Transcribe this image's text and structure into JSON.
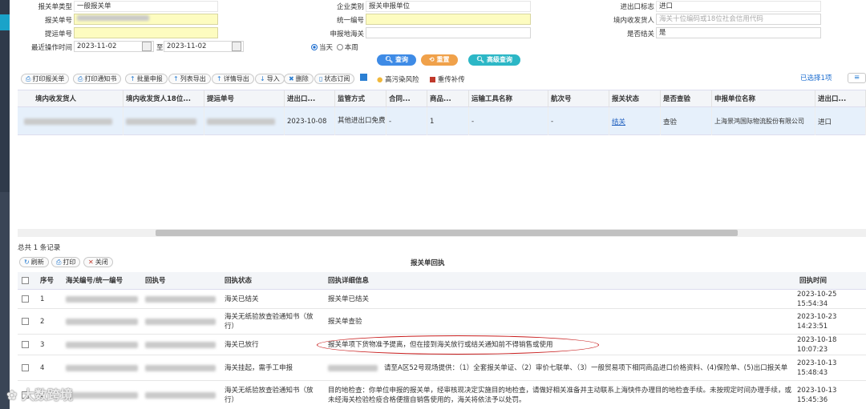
{
  "filters": {
    "decl_type_label": "报关单类型",
    "decl_type_value": "一般报关单",
    "enterprise_type_label": "企业类别",
    "enterprise_type_value": "报关申报单位",
    "ie_flag_label": "进出口标志",
    "ie_flag_value": "进口",
    "decl_no_label": "报关单号",
    "unified_no_label": "统一编号",
    "consignee_label": "境内收发货人",
    "consignee_placeholder": "海关十位编码或18位社会信用代码",
    "bl_no_label": "提运单号",
    "customs_label": "申报地海关",
    "checked_label": "是否结关",
    "checked_value": "是",
    "op_time_label": "最近操作时间",
    "date_from": "2023-11-02",
    "to_label": "至",
    "date_to": "2023-11-02",
    "radio_today": "当天",
    "radio_week": "本周"
  },
  "actions": {
    "query": "查询",
    "reset": "重置",
    "advanced": "高级查询"
  },
  "toolbar": {
    "print_decl": "打印报关单",
    "print_notice": "打印通知书",
    "batch_decl": "批量申报",
    "list_export": "列表导出",
    "detail_export": "详情导出",
    "import": "导入",
    "delete": "删除",
    "subscribe": "状态订阅",
    "pollution_risk": "高污染风险",
    "resend": "重传补传",
    "selected": "已选择1项",
    "colors": {
      "query": "#3e8be6",
      "reset": "#f0a14a",
      "advanced": "#2cb7c6",
      "resend": "#c0392b",
      "risk": "#f1b83b"
    }
  },
  "grid": {
    "headers": [
      "境内收发货人",
      "境内收发货人18位...",
      "提运单号",
      "进出口...",
      "监管方式",
      "合同...",
      "商品...",
      "运输工具名称",
      "航次号",
      "报关状态",
      "是否查验",
      "申报单位名称",
      "进出口..."
    ],
    "row": {
      "ie_date": "2023-10-08",
      "supervision": "其他进出口免费",
      "contract": "-",
      "goods": "1",
      "transport": "-",
      "voyage": "-",
      "status": "结关",
      "inspected": "查验",
      "applicant": "上海景鸿国际物流股份有限公司",
      "ie": "进口"
    },
    "total": "总共 1 条记录"
  },
  "receipt": {
    "refresh": "刷新",
    "print": "打印",
    "close": "关闭",
    "title": "报关单回执",
    "headers": [
      "序号",
      "海关编号/统一编号",
      "回执号",
      "回执状态",
      "回执详细信息",
      "回执时间"
    ],
    "rows": [
      {
        "no": "1",
        "status": "海关已结关",
        "detail": "报关单已结关",
        "time": "2023-10-25 15:54:34"
      },
      {
        "no": "2",
        "status": "海关无纸验放查验通知书（放行）",
        "detail": "报关单查验",
        "time": "2023-10-23 14:23:51"
      },
      {
        "no": "3",
        "status": "海关已放行",
        "detail": "报关单项下货物准予提离，但在接到海关放行或结关通知前不得销售或使用",
        "time": "2023-10-18 10:07:23"
      },
      {
        "no": "4",
        "status": "海关挂起，需手工申报",
        "detail": "请至A区52号现场提供：（1）全套报关单证、（2）审价七联单、（3）一般贸易项下相同商品进口价格资料、(4)保险单、(5)出口报关单",
        "time": "2023-10-13 15:48:43"
      },
      {
        "no": "5",
        "status": "海关无纸验放查验通知书（放行）",
        "detail": "目的地检查：你单位申报的报关单，经审核现决定实施目的地检查，请做好相关准备并主动联系上海快件办理目的地检查手续。未按规定时间办理手续，或未经海关检验检疫合格便擅自销售使用的，海关将依法予以处罚。",
        "time": "2023-10-13 15:45:36"
      }
    ]
  },
  "watermark": "大数跨境"
}
